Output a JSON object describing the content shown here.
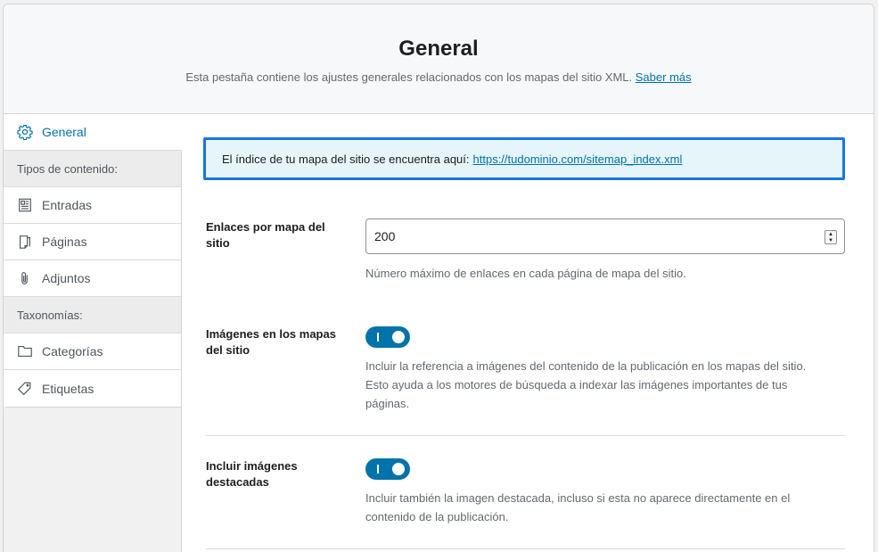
{
  "header": {
    "title": "General",
    "subtitle": "Esta pestaña contiene los ajustes generales relacionados con los mapas del sitio XML.",
    "learn_more": "Saber más"
  },
  "sidebar": {
    "general": {
      "label": "General",
      "icon": "gear-icon"
    },
    "content_types_heading": "Tipos de contenido:",
    "content_types": [
      {
        "label": "Entradas",
        "icon": "posts-icon"
      },
      {
        "label": "Páginas",
        "icon": "pages-icon"
      },
      {
        "label": "Adjuntos",
        "icon": "paperclip-icon"
      }
    ],
    "taxonomies_heading": "Taxonomías:",
    "taxonomies": [
      {
        "label": "Categorías",
        "icon": "folder-icon"
      },
      {
        "label": "Etiquetas",
        "icon": "tag-icon"
      }
    ]
  },
  "notice": {
    "text": "El índice de tu mapa del sitio se encuentra aquí:",
    "link": "https://tudominio.com/sitemap_index.xml"
  },
  "settings": {
    "links_per_sitemap": {
      "label": "Enlaces por mapa del sitio",
      "value": "200",
      "description": "Número máximo de enlaces en cada página de mapa del sitio."
    },
    "images_in_sitemap": {
      "label": "Imágenes en los mapas del sitio",
      "enabled": true,
      "description": "Incluir la referencia a imágenes del contenido de la publicación en los mapas del sitio. Esto ayuda a los motores de búsqueda a indexar las imágenes importantes de tus páginas."
    },
    "featured_images": {
      "label": "Incluir imágenes destacadas",
      "enabled": true,
      "description": "Incluir también la imagen destacada, incluso si esta no aparece directamente en el contenido de la publicación."
    }
  },
  "colors": {
    "accent": "#0073aa",
    "notice_border": "#1a73e8",
    "notice_bg": "#e5f5fa"
  }
}
